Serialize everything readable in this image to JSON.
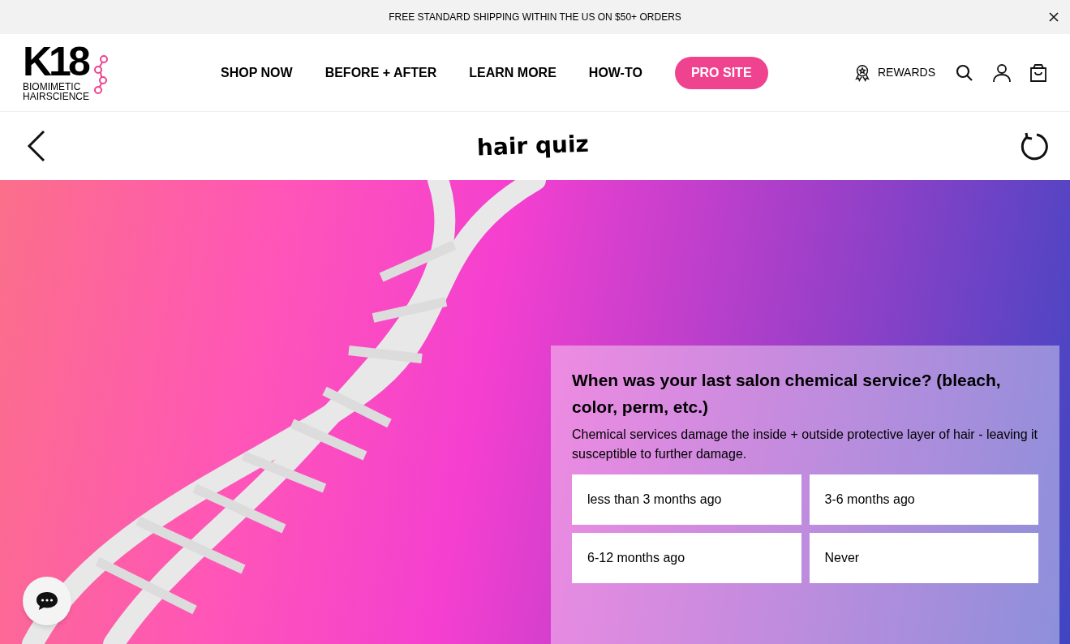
{
  "announcement": {
    "text": "FREE STANDARD SHIPPING WITHIN THE US ON $50+ ORDERS"
  },
  "logo": {
    "mark": "K18",
    "tagline_1": "BIOMIMETIC",
    "tagline_2": "HAIRSCIENCE"
  },
  "nav": [
    {
      "label": "SHOP NOW",
      "kind": "link"
    },
    {
      "label": "BEFORE + AFTER",
      "kind": "link"
    },
    {
      "label": "LEARN MORE",
      "kind": "link"
    },
    {
      "label": "HOW-TO",
      "kind": "link"
    },
    {
      "label": "PRO SITE",
      "kind": "pill"
    }
  ],
  "rewards": {
    "label": "REWARDS"
  },
  "quiz_bar": {
    "title": "hair quiz"
  },
  "question": {
    "title": "When was your last salon chemical service? (bleach, color, perm, etc.)",
    "description": "Chemical services damage the inside + outside protective layer of hair - leaving it susceptible to further damage.",
    "options": [
      {
        "label": "less than 3 months ago",
        "selected": false
      },
      {
        "label": "3-6 months ago",
        "selected": false
      },
      {
        "label": "6-12 months ago",
        "selected": false
      },
      {
        "label": "Never",
        "selected": false
      }
    ]
  }
}
